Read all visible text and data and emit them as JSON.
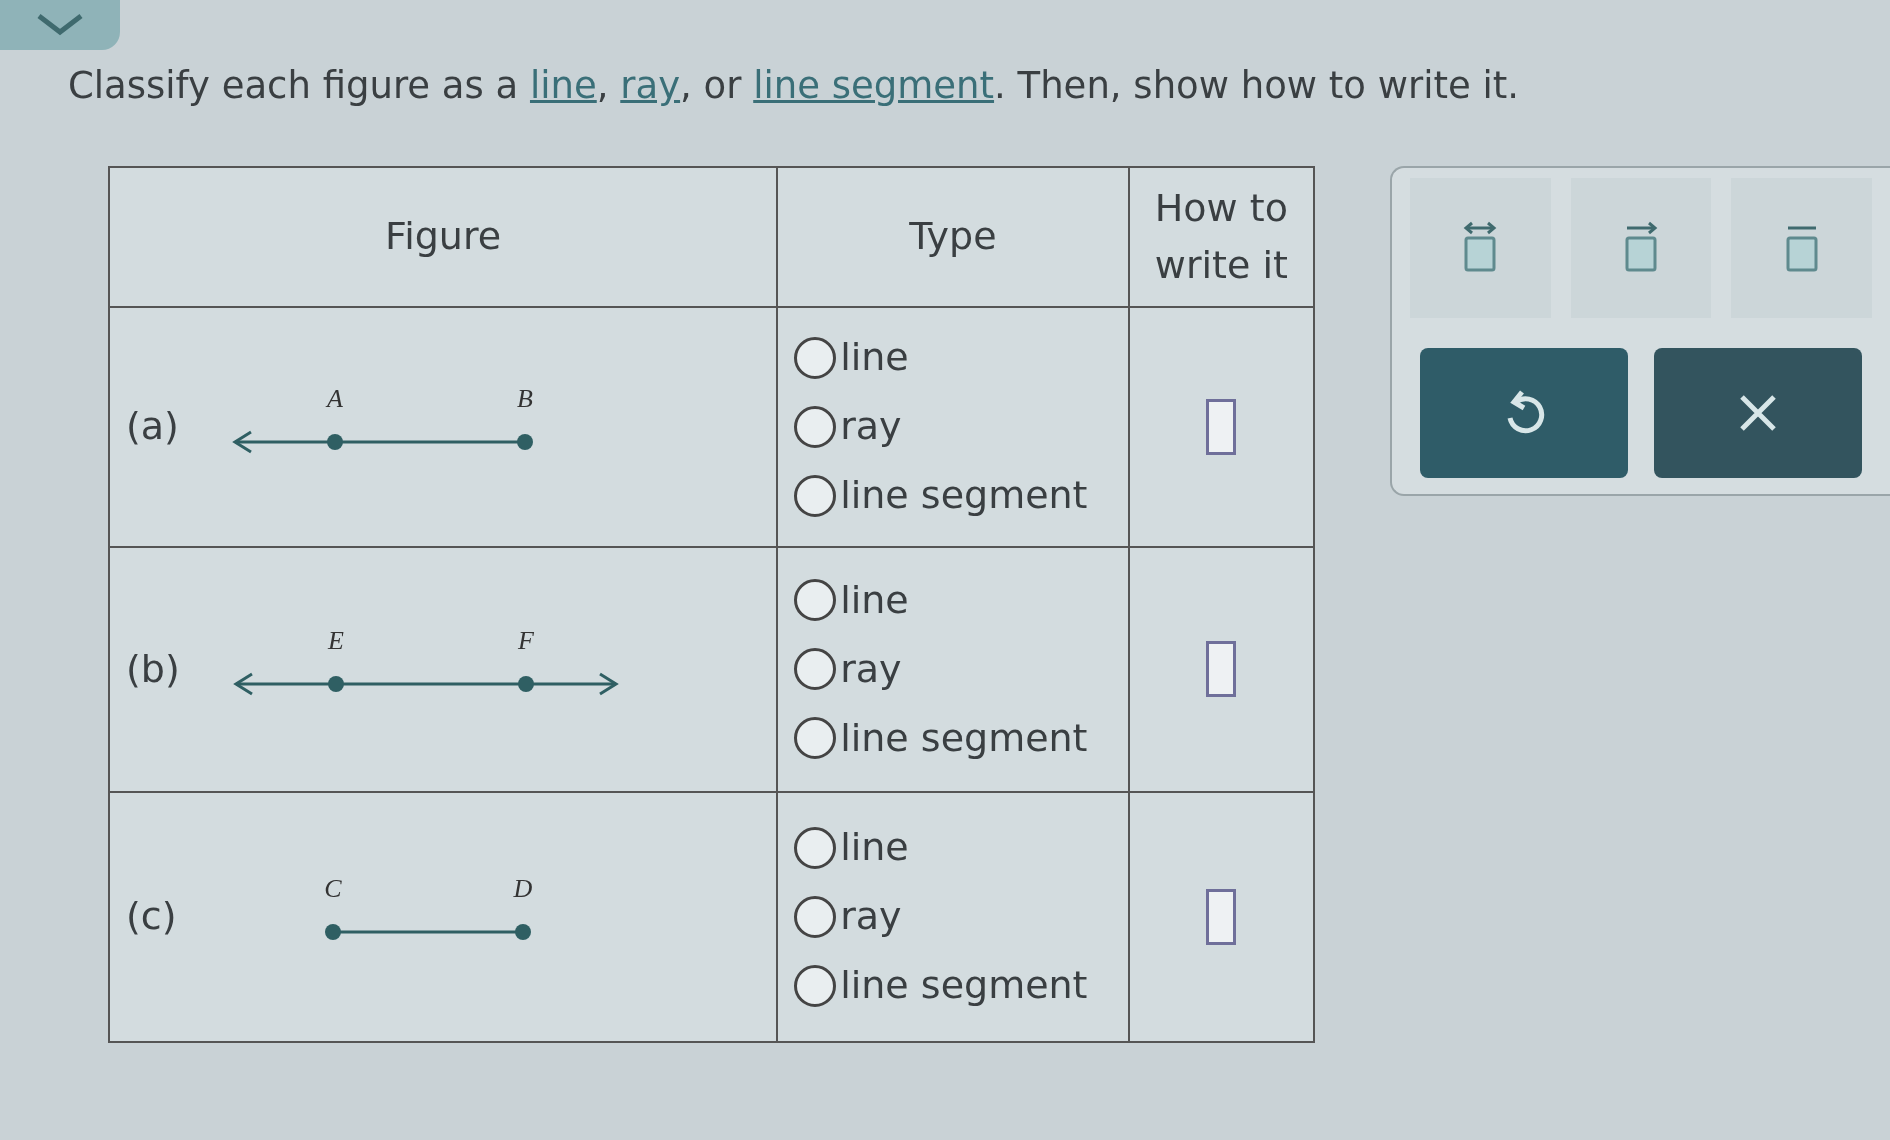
{
  "instruction": [
    {
      "kind": "text",
      "text": "Classify each figure as a "
    },
    {
      "kind": "link",
      "text": "line"
    },
    {
      "kind": "text",
      "text": ", "
    },
    {
      "kind": "link",
      "text": "ray"
    },
    {
      "kind": "text",
      "text": ", or "
    },
    {
      "kind": "link",
      "text": "line segment"
    },
    {
      "kind": "text",
      "text": ". Then, show how to write it."
    }
  ],
  "table": {
    "columns": [
      "Figure",
      "Type",
      "How to write it"
    ],
    "rows": [
      {
        "label": "(a)",
        "figure": {
          "arrow_start": true,
          "arrow_end": false,
          "points": [
            "A",
            "B"
          ]
        },
        "options": [
          {
            "label": "line",
            "selected": false
          },
          {
            "label": "ray",
            "selected": false
          },
          {
            "label": "line segment",
            "selected": false
          }
        ]
      },
      {
        "label": "(b)",
        "figure": {
          "arrow_start": true,
          "arrow_end": true,
          "points": [
            "E",
            "F"
          ]
        },
        "options": [
          {
            "label": "line",
            "selected": false
          },
          {
            "label": "ray",
            "selected": false
          },
          {
            "label": "line segment",
            "selected": false
          }
        ]
      },
      {
        "label": "(c)",
        "figure": {
          "arrow_start": false,
          "arrow_end": false,
          "points": [
            "C",
            "D"
          ]
        },
        "options": [
          {
            "label": "line",
            "selected": false
          },
          {
            "label": "ray",
            "selected": false
          },
          {
            "label": "line segment",
            "selected": false
          }
        ]
      }
    ]
  },
  "toolbar": {
    "tools": [
      {
        "kind": "line"
      },
      {
        "kind": "ray"
      },
      {
        "kind": "segment"
      }
    ]
  }
}
